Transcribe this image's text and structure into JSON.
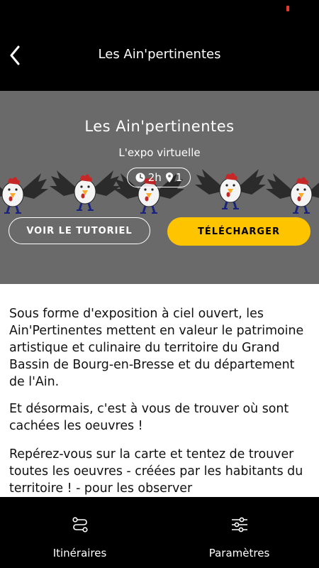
{
  "header": {
    "title": "Les Ain'pertinentes",
    "back_icon": "chevron-left-icon"
  },
  "hero": {
    "title": "Les Ain'pertinentes",
    "subtitle": "L'expo virtuelle",
    "duration": "2h",
    "locations": "1",
    "tutorial_label": "VOIR LE TUTORIEL",
    "download_label": "TÉLÉCHARGER",
    "accent_color": "#ffc400"
  },
  "content": {
    "paragraphs": [
      "Sous forme d'exposition à ciel ouvert, les Ain'Pertinentes mettent en valeur le patrimoine artistique et culinaire du territoire du Grand Bassin de Bourg-en-Bresse et du département de l'Ain.",
      "Et désormais, c'est à vous de trouver où sont cachées les oeuvres !",
      "Repérez-vous sur la carte et tentez de trouver toutes les oeuvres - créées par les habitants du territoire ! - pour les observer"
    ]
  },
  "nav": {
    "itineraries_label": "Itinéraires",
    "settings_label": "Paramètres",
    "itineraries_icon": "route-icon",
    "settings_icon": "sliders-icon"
  }
}
